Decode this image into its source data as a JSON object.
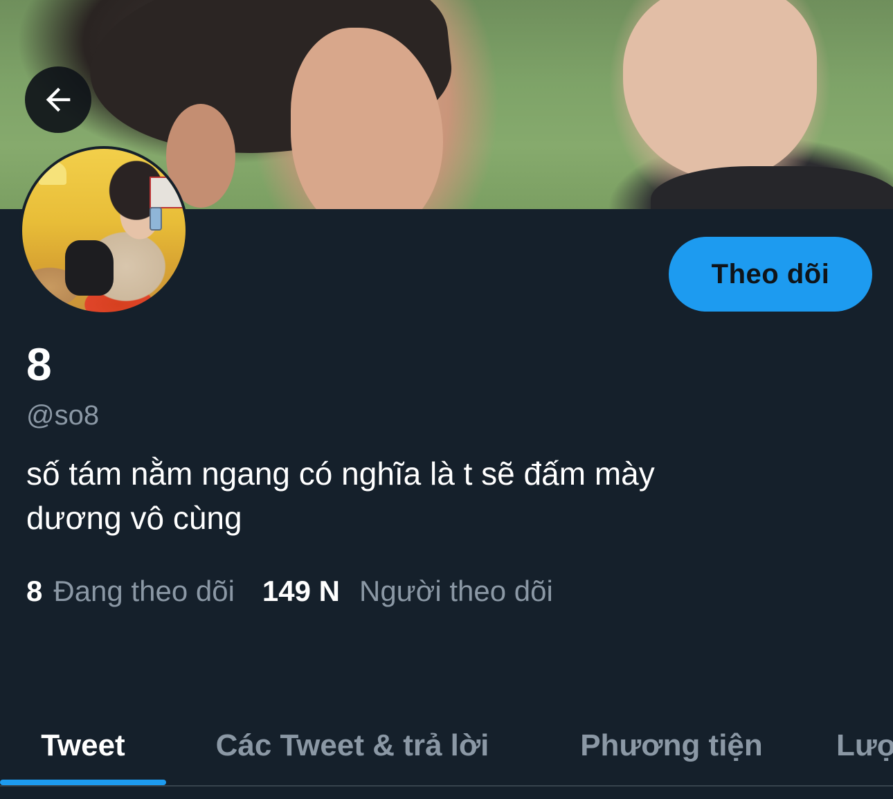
{
  "colors": {
    "background": "#15202b",
    "accent": "#1d9bf0",
    "secondary_text": "#8b98a5",
    "primary_text": "#ffffff"
  },
  "header": {
    "back_icon": "arrow-left-icon"
  },
  "profile": {
    "follow_label": "Theo dõi",
    "display_name": "8",
    "handle": "@so8",
    "bio_line1": "số tám nằm ngang có nghĩa là t sẽ đấm mày",
    "bio_line2": "dương vô cùng"
  },
  "stats": {
    "following_count": "8",
    "following_label": "Đang theo dõi",
    "followers_count": "149 N",
    "followers_label": "Người theo dõi"
  },
  "tabs": [
    {
      "label": "Tweet",
      "active": true
    },
    {
      "label": "Các Tweet & trả lời",
      "active": false
    },
    {
      "label": "Phương tiện",
      "active": false
    },
    {
      "label": "Lượt thích",
      "active": false
    }
  ]
}
